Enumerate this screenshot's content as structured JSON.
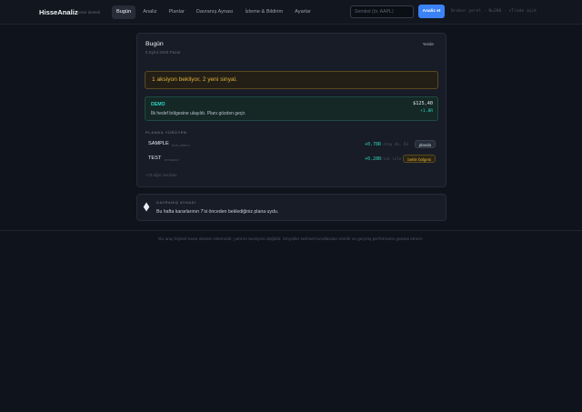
{
  "header": {
    "brand": "HisseAnaliz",
    "brand_sub": "karar destek",
    "nav": [
      {
        "label": "Bugün",
        "active": true
      },
      {
        "label": "Analiz",
        "active": false
      },
      {
        "label": "Planlar",
        "active": false
      },
      {
        "label": "Davranış Aynası",
        "active": false
      },
      {
        "label": "İzleme & Bildirim",
        "active": false
      },
      {
        "label": "Ayarlar",
        "active": false
      }
    ],
    "search_placeholder": "Sembol (ör. AAPL)",
    "analyze_label": "Analiz et",
    "status": "Broker yerel · N=200 · cTrade açık"
  },
  "today": {
    "title": "Bugün",
    "date": "8 Eylül 2026 Pazar",
    "refresh_label": "Yenile",
    "alert": "1 aksiyon bekliyor, 2 yeni sinyal.",
    "demo": {
      "title": "DEMO",
      "text": "İlk hedef bölgesine ulaşıldı. Planı gözden geçir.",
      "price": "$125,40",
      "change": "+1.8R"
    },
    "section_label": "PLANDA YÜRÜYEN",
    "plans": [
      {
        "symbol": "SAMPLE",
        "sub": "bull pattern",
        "pct": "+0.78R",
        "detail": "stop 4%, R3",
        "status": "planda"
      },
      {
        "symbol": "TEST",
        "sub": "breakout",
        "pct": "+0.28R",
        "detail": "risk izle R3",
        "status": "bekle bölgesi"
      }
    ],
    "more_link": "+78 diğer sembole"
  },
  "mirror": {
    "label": "DAVRANIŞ AYNASI",
    "text": "Bu hafta kararlarının 7'si önceden beklediğiniz plana uydu."
  },
  "footer": "Bu araç kişisel karar destek sistemidir; yatırım tavsiyesi değildir. Sinyaller tarihsel kurallardan üretilir ve geçmiş performans garanti etmez.",
  "colors": {
    "background": "#0f131c",
    "accent": "#3b82f6",
    "teal": "#2dd4bf",
    "amber": "#e0b23a"
  }
}
